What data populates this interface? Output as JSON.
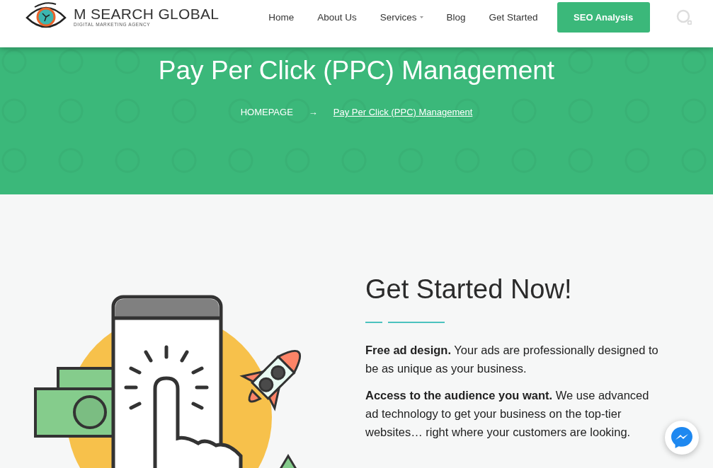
{
  "header": {
    "brand": "M SEARCH GLOBAL",
    "tagline": "DIGITAL MARKETING AGENCY",
    "nav": [
      {
        "label": "Home",
        "has_dropdown": false
      },
      {
        "label": "About Us",
        "has_dropdown": false
      },
      {
        "label": "Services",
        "has_dropdown": true
      },
      {
        "label": "Blog",
        "has_dropdown": false
      },
      {
        "label": "Get Started",
        "has_dropdown": false
      }
    ],
    "cta": "SEO Analysis"
  },
  "hero": {
    "title": "Pay Per Click (PPC) Management",
    "breadcrumb": [
      {
        "label": "HOMEPAGE",
        "current": false
      },
      {
        "label": "Pay Per Click (PPC) Management",
        "current": true
      }
    ],
    "separator": "→"
  },
  "content": {
    "heading": "Get Started Now!",
    "paragraphs": [
      "**Free ad design.** Your ads are professionally designed to be as unique as your business.",
      "**Access to the audience you want.** We use advanced ad technology to get your business on the top-tier websites… right where your customers are looking."
    ]
  }
}
